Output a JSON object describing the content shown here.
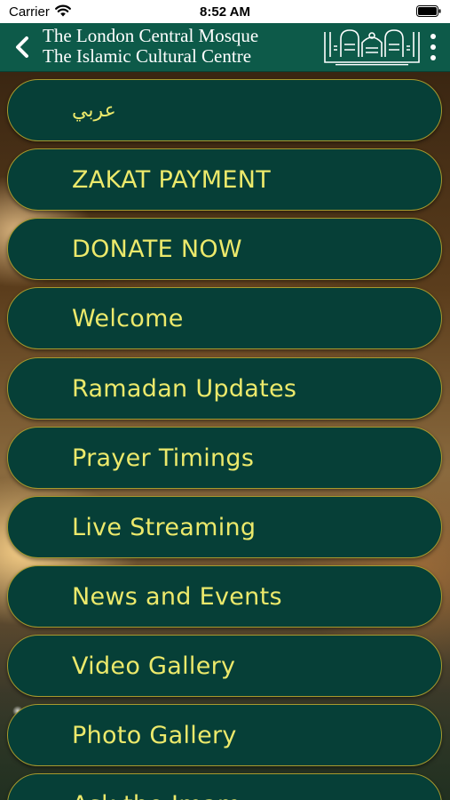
{
  "status_bar": {
    "carrier": "Carrier",
    "time": "8:52 AM"
  },
  "header": {
    "title_line1": "The London Central Mosque",
    "title_line2": "The Islamic Cultural Centre",
    "logo_icon": "mosque-logo-icon",
    "background_color": "#0d5a49"
  },
  "menu": {
    "items": [
      {
        "label": "عربي"
      },
      {
        "label": "ZAKAT PAYMENT"
      },
      {
        "label": "DONATE NOW"
      },
      {
        "label": "Welcome"
      },
      {
        "label": "Ramadan Updates"
      },
      {
        "label": "Prayer Timings"
      },
      {
        "label": "Live Streaming"
      },
      {
        "label": "News and Events"
      },
      {
        "label": "Video Gallery"
      },
      {
        "label": "Photo Gallery"
      },
      {
        "label": "Ask the Imam"
      }
    ],
    "item_background": "#063f37",
    "item_border": "#a79a2e",
    "item_text_color": "#ece96b"
  }
}
